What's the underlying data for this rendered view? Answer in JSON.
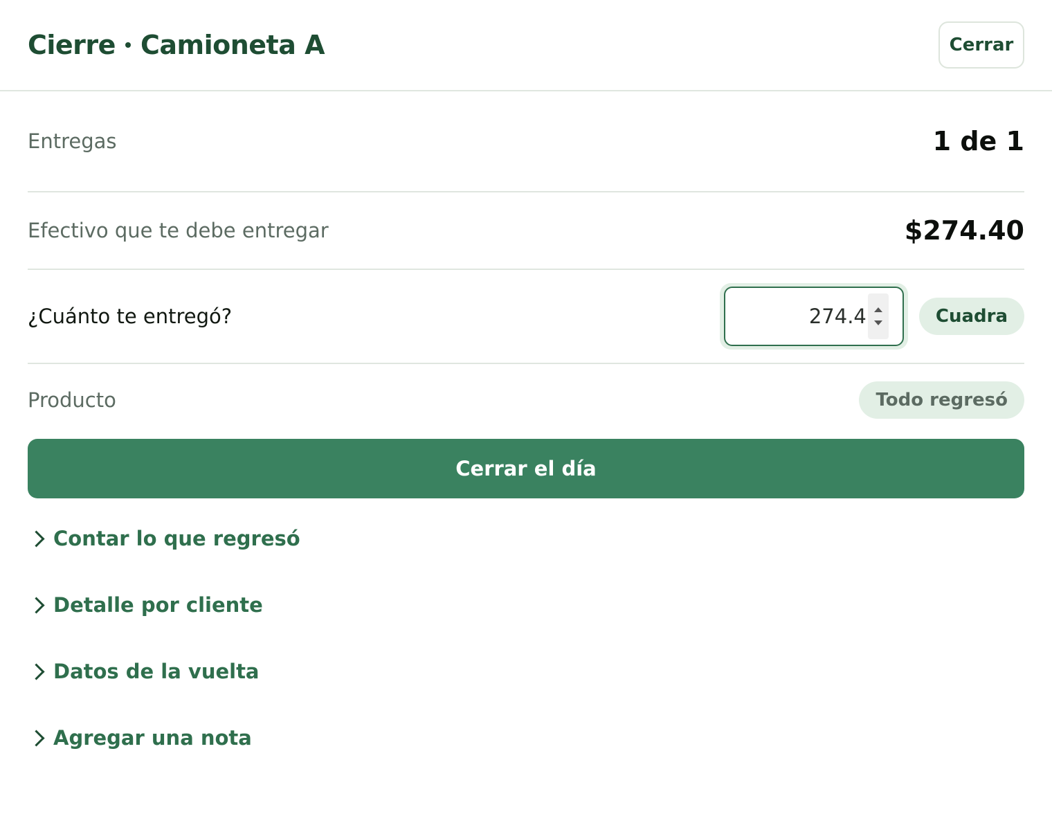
{
  "header": {
    "title_part1": "Cierre",
    "title_part2": "Camioneta A",
    "close_label": "Cerrar"
  },
  "summary": {
    "deliveries_label": "Entregas",
    "deliveries_value": "1 de 1",
    "cash_label": "Efectivo que te debe entregar",
    "cash_value": "$274.40",
    "received_label": "¿Cuánto te entregó?",
    "received_value": "274.4",
    "received_status": "Cuadra",
    "product_label": "Producto",
    "product_status": "Todo regresó"
  },
  "primary_action": {
    "label": "Cerrar el día"
  },
  "sections": [
    {
      "label": "Contar lo que regresó"
    },
    {
      "label": "Detalle por cliente"
    },
    {
      "label": "Datos de la vuelta"
    },
    {
      "label": "Agregar una nota"
    }
  ],
  "colors": {
    "brand_dark": "#1e4d33",
    "brand_primary": "#3a8260",
    "pill_background": "#e2efe5",
    "divider": "#dfe6df"
  }
}
